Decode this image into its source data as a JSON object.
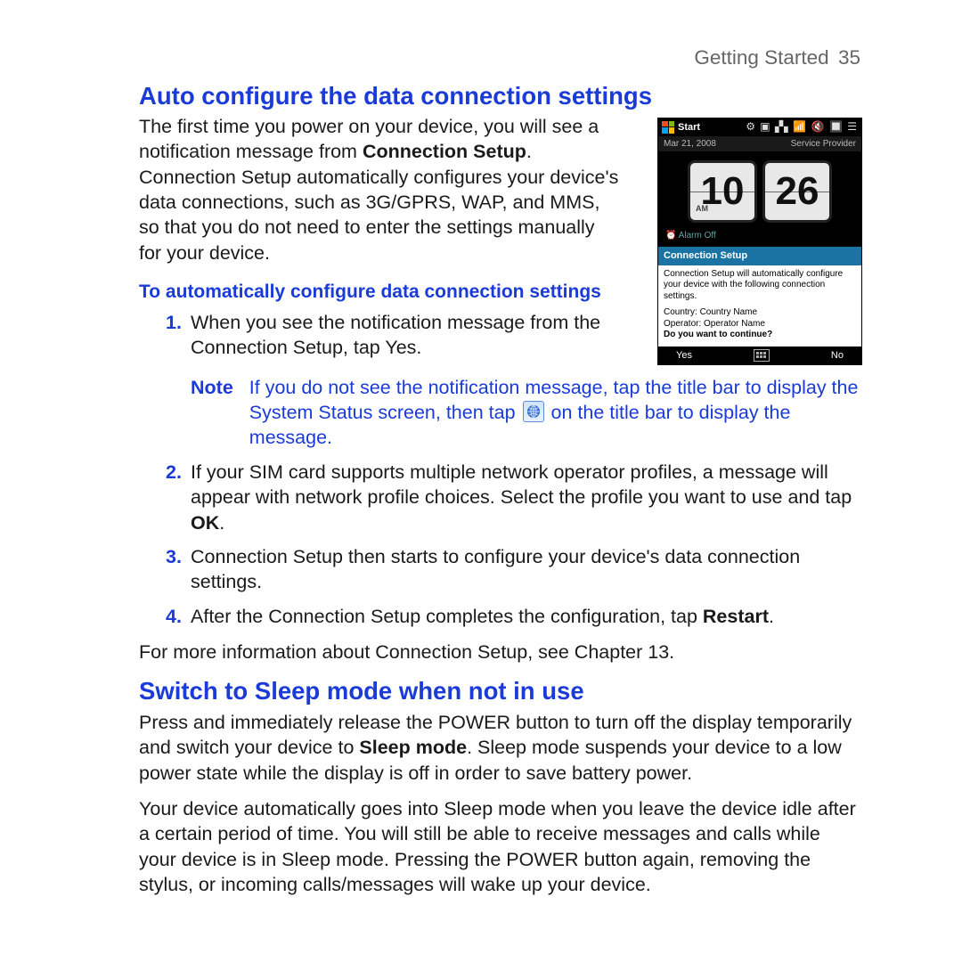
{
  "header": {
    "section": "Getting Started",
    "page": "35"
  },
  "h2a": "Auto configure the data connection settings",
  "intro": {
    "p1a": "The first time you power on your device, you will see a notification message from ",
    "p1b": "Connection Setup",
    "p1c": ". Connection Setup automatically configures your device's data connections, such as 3G/GPRS, WAP, and MMS, so that you do not need to enter the settings manually for your device."
  },
  "h3a": "To automatically configure data connection settings",
  "steps": {
    "s1": "When you see the notification message from the Connection Setup, tap Yes.",
    "s2a": "If your SIM card supports multiple network operator profiles, a message will appear with network profile choices. Select the profile you want to use and tap ",
    "s2b": "OK",
    "s2c": ".",
    "s3": "Connection Setup then starts to configure your device's data connection settings.",
    "s4a": "After the Connection Setup completes the configuration, tap ",
    "s4b": "Restart",
    "s4c": "."
  },
  "note": {
    "label": "Note",
    "t1": "If you do not see the notification message, tap the title bar to display the System Status screen, then tap ",
    "t2": " on the title bar to display the message."
  },
  "closing": "For more information about Connection Setup, see Chapter 13.",
  "h2b": "Switch to Sleep mode when not in use",
  "sleep": {
    "p1a": "Press and immediately release the POWER button to turn off the display temporarily and switch your device to ",
    "p1b": "Sleep mode",
    "p1c": ". Sleep mode suspends your device to a low power state while the display is off in order to save battery power.",
    "p2": "Your device automatically goes into Sleep mode when you leave the device idle after a certain period of time. You will still be able to receive messages and calls while your device is in Sleep mode. Pressing the POWER button again, removing the stylus, or incoming calls/messages will wake up your device."
  },
  "device": {
    "start": "Start",
    "date": "Mar 21, 2008",
    "provider": "Service Provider",
    "hour": "10",
    "minute": "26",
    "ampm": "AM",
    "alarm": "⏰ Alarm Off",
    "conn_title": "Connection Setup",
    "conn_msg": "Connection Setup will automatically configure your device with the following connection settings.",
    "conn_country": "Country: Country Name",
    "conn_operator": "Operator: Operator Name",
    "conn_q": "Do you want to continue?",
    "yes": "Yes",
    "no": "No",
    "status_symbols": "⚙ ▣ ▞▖📶 🔇 🔲 ☰"
  }
}
